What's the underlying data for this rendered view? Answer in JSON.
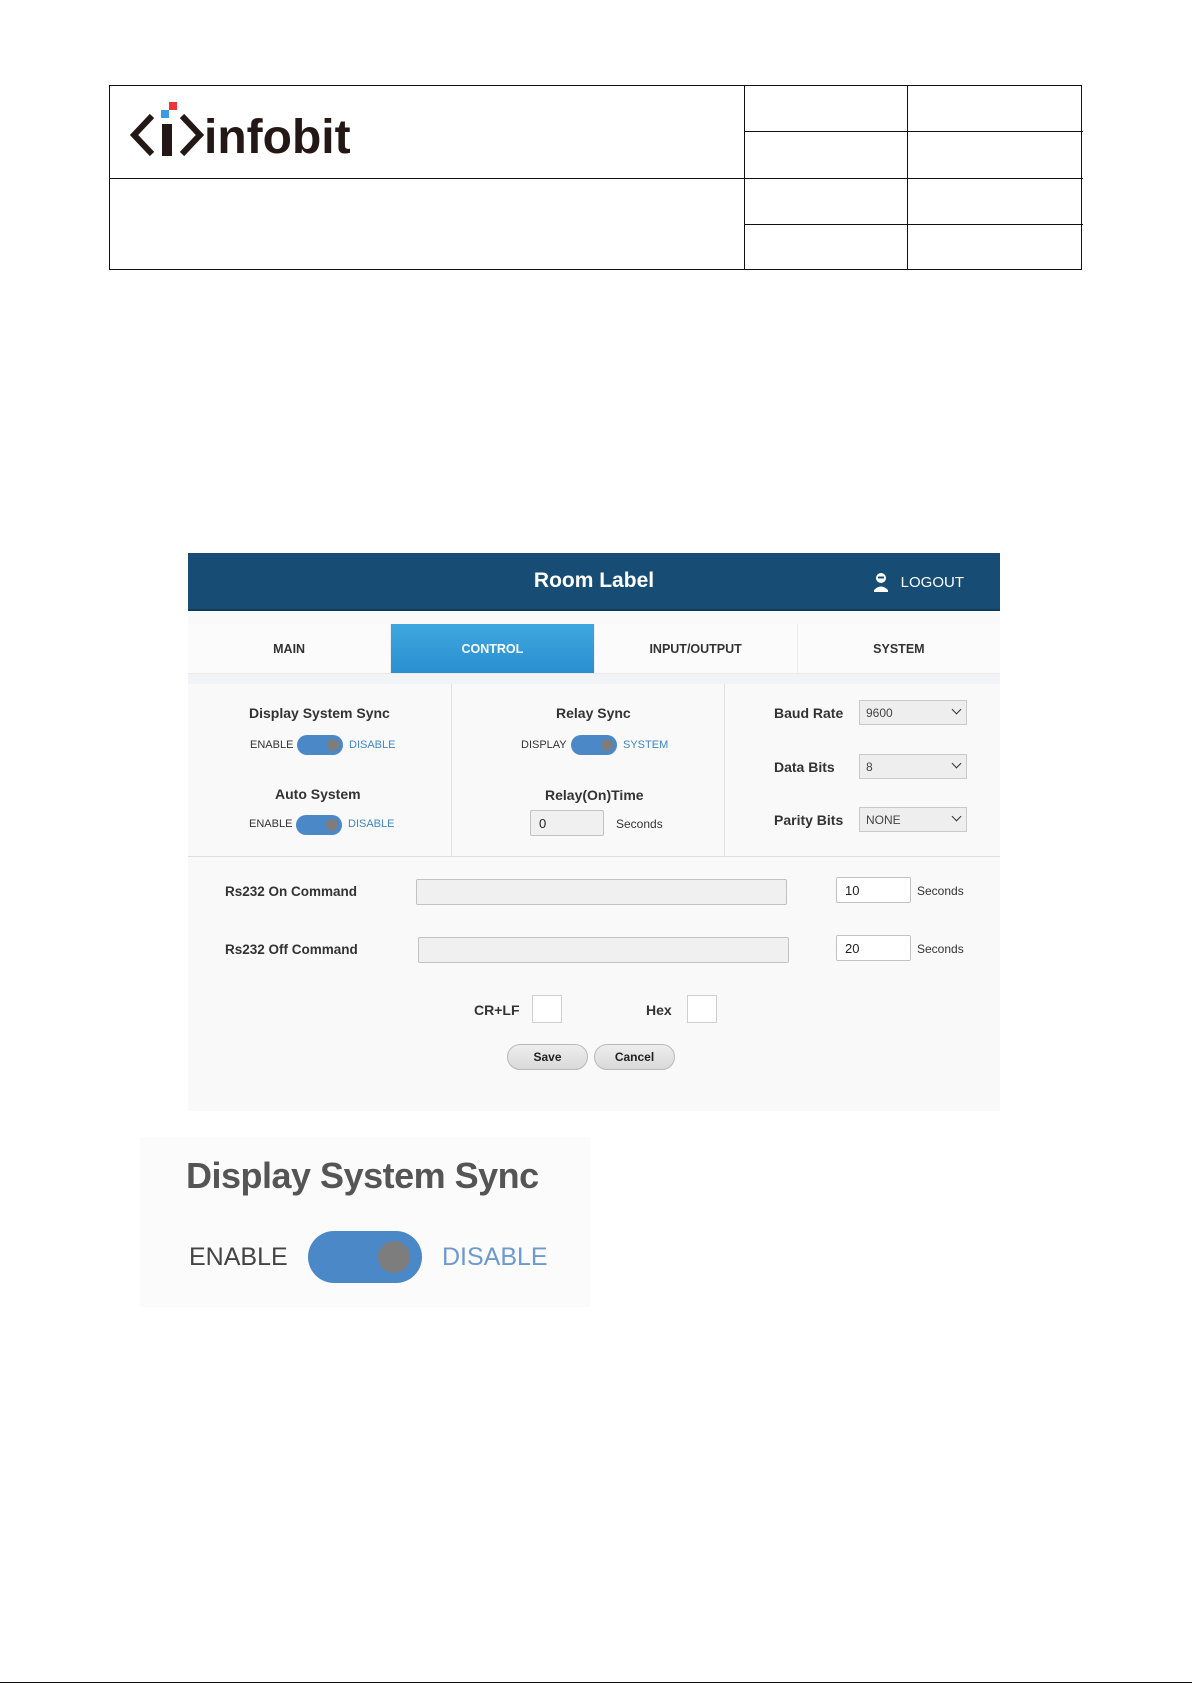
{
  "logo": {
    "text": "infobit"
  },
  "ui": {
    "title": "Room Label",
    "logout": "LOGOUT",
    "tabs": [
      {
        "label": "MAIN",
        "active": false
      },
      {
        "label": "CONTROL",
        "active": true
      },
      {
        "label": "INPUT/OUTPUT",
        "active": false
      },
      {
        "label": "SYSTEM",
        "active": false
      }
    ],
    "display_system_sync": {
      "label": "Display System Sync",
      "left": "ENABLE",
      "right": "DISABLE"
    },
    "auto_system": {
      "label": "Auto System",
      "left": "ENABLE",
      "right": "DISABLE"
    },
    "relay_sync": {
      "label": "Relay Sync",
      "left": "DISPLAY",
      "right": "SYSTEM"
    },
    "relay_on_time": {
      "label": "Relay(On)Time",
      "value": "0",
      "unit": "Seconds"
    },
    "baud_rate": {
      "label": "Baud Rate",
      "value": "9600"
    },
    "data_bits": {
      "label": "Data Bits",
      "value": "8"
    },
    "parity_bits": {
      "label": "Parity Bits",
      "value": "NONE"
    },
    "rs232_on": {
      "label": "Rs232 On Command",
      "value": "",
      "delay": "10",
      "unit": "Seconds"
    },
    "rs232_off": {
      "label": "Rs232 Off Command",
      "value": "",
      "delay": "20",
      "unit": "Seconds"
    },
    "crlf": "CR+LF",
    "hex": "Hex",
    "save": "Save",
    "cancel": "Cancel"
  },
  "zoom": {
    "title": "Display System Sync",
    "left": "ENABLE",
    "right": "DISABLE"
  },
  "colors": {
    "header": "#174c75",
    "tab_active": "#3399d9",
    "toggle": "#4a88c7"
  }
}
